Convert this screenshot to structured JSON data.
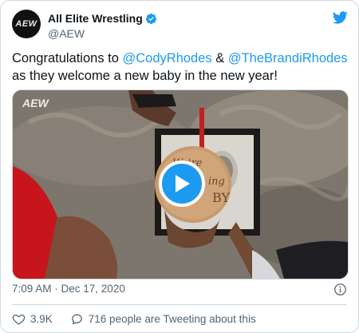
{
  "account": {
    "display_name": "All Elite Wrestling",
    "handle": "@AEW",
    "avatar_text": "AEW"
  },
  "tweet": {
    "text_1": "Congratulations to ",
    "mention_1": "@CodyRhodes",
    "text_2": " & ",
    "mention_2": "@TheBrandiRhodes",
    "text_3": " as they welcome a new baby in the new year!"
  },
  "media": {
    "watermark": "AEW",
    "ornament_text_1": "We're",
    "ornament_text_2": "ing",
    "ornament_text_3": "BY"
  },
  "meta": {
    "timestamp": "7:09 AM · Dec 17, 2020"
  },
  "actions": {
    "likes": "3.9K",
    "tweeting": "716 people are Tweeting about this"
  },
  "icons": {
    "verified": "verified-badge-icon",
    "bird": "twitter-bird-icon",
    "play": "play-icon",
    "info": "info-icon",
    "like": "heart-icon",
    "reply": "speech-bubble-icon"
  },
  "colors": {
    "accent": "#1d9bf0",
    "text": "#0f1419",
    "muted": "#536471",
    "border": "#cfd9de"
  }
}
